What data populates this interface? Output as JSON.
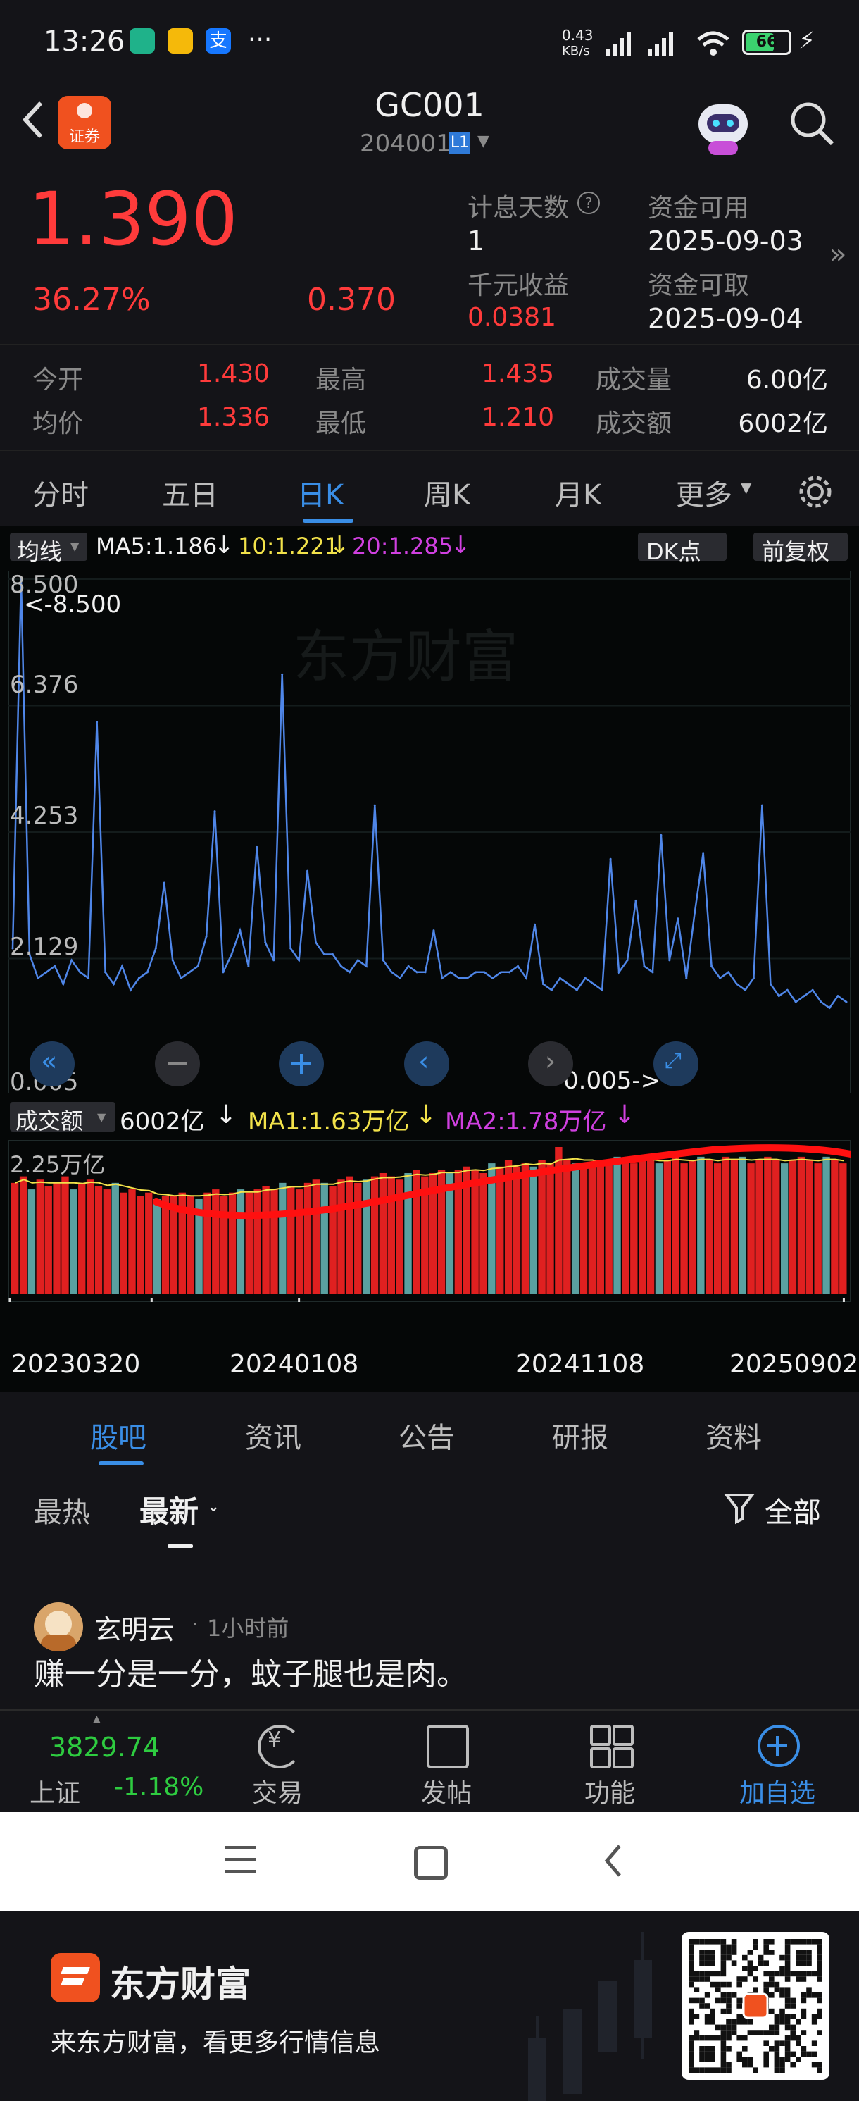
{
  "status_bar": {
    "time": "13:26",
    "net_speed_top": "0.43",
    "net_speed_unit": "KB/s",
    "battery": "66",
    "more": "···"
  },
  "header": {
    "title": "GC001",
    "code": "204001",
    "level": "L1",
    "badge_text": "证券"
  },
  "quote": {
    "price": "1.390",
    "change_pct": "36.27%",
    "change_abs": "0.370",
    "interest_days_label": "计息天数",
    "interest_days_value": "1",
    "per_thousand_label": "千元收益",
    "per_thousand_value": "0.0381",
    "funds_available_label": "资金可用",
    "funds_available_date": "2025-09-03",
    "funds_withdrawable_label": "资金可取",
    "funds_withdrawable_date": "2025-09-04"
  },
  "stats": [
    {
      "label": "今开",
      "value": "1.430"
    },
    {
      "label": "最高",
      "value": "1.435"
    },
    {
      "label": "成交量",
      "value": "6.00亿"
    },
    {
      "label": "均价",
      "value": "1.336"
    },
    {
      "label": "最低",
      "value": "1.210"
    },
    {
      "label": "成交额",
      "value": "6002亿"
    }
  ],
  "tabs": [
    "分时",
    "五日",
    "日K",
    "周K",
    "月K",
    "更多"
  ],
  "active_tab": "日K",
  "indicator_bar": {
    "selector": "均线",
    "ma5": "MA5:1.186",
    "ma10": "10:1.221",
    "ma20": "20:1.285",
    "dk": "DK点",
    "adjust": "前复权"
  },
  "price_chart_labels": {
    "y_top": "8.500",
    "y2": "6.376",
    "y3": "4.253",
    "y4": "2.129",
    "y_bottom": "0.005",
    "max_marker": "<-8.500",
    "min_marker": "0.005->",
    "watermark": "东方财富"
  },
  "volume_bar": {
    "selector": "成交额",
    "value": "6002亿",
    "ma1": "MA1:1.63万亿",
    "ma2": "MA2:1.78万亿",
    "y_top": "2.25万亿"
  },
  "x_dates": [
    "20230320",
    "20240108",
    "20241108",
    "20250902"
  ],
  "chart_data": {
    "type": "line",
    "title": "",
    "xlabel": "",
    "ylabel": "",
    "ylim": [
      0.005,
      8.5
    ],
    "x_range": [
      "20230320",
      "20250902"
    ],
    "series": [
      {
        "values": [
          2.3,
          8.5,
          2.2,
          1.8,
          1.9,
          2.0,
          1.7,
          2.1,
          1.9,
          1.8,
          6.1,
          1.9,
          1.7,
          2.0,
          1.6,
          1.8,
          1.9,
          2.3,
          3.4,
          2.1,
          1.8,
          1.9,
          2.0,
          2.5,
          4.6,
          1.9,
          2.2,
          2.6,
          2.0,
          4.0,
          2.4,
          2.1,
          6.9,
          2.3,
          2.1,
          3.6,
          2.4,
          2.2,
          2.2,
          2.0,
          1.9,
          2.1,
          2.0,
          4.7,
          2.1,
          1.9,
          1.8,
          2.0,
          1.9,
          1.9,
          2.6,
          1.8,
          1.9,
          1.8,
          1.8,
          1.9,
          1.9,
          1.8,
          1.9,
          1.9,
          2.0,
          1.8,
          2.7,
          1.7,
          1.6,
          1.8,
          1.7,
          1.6,
          1.8,
          1.7,
          1.6,
          3.8,
          1.9,
          2.1,
          3.1,
          2.0,
          1.9,
          4.2,
          2.1,
          2.8,
          1.8,
          2.9,
          3.9,
          2.0,
          1.8,
          1.9,
          1.7,
          1.6,
          1.8,
          4.7,
          1.7,
          1.5,
          1.6,
          1.4,
          1.5,
          1.6,
          1.4,
          1.3,
          1.5,
          1.4
        ]
      }
    ],
    "volume": {
      "ylim": [
        0,
        2.25
      ],
      "unit": "万亿",
      "values": [
        1.7,
        1.8,
        1.6,
        1.75,
        1.65,
        1.7,
        1.8,
        1.6,
        1.7,
        1.75,
        1.65,
        1.6,
        1.7,
        1.55,
        1.6,
        1.5,
        1.55,
        1.45,
        1.5,
        1.5,
        1.55,
        1.5,
        1.45,
        1.55,
        1.6,
        1.5,
        1.55,
        1.6,
        1.55,
        1.6,
        1.65,
        1.6,
        1.7,
        1.65,
        1.6,
        1.7,
        1.75,
        1.7,
        1.65,
        1.75,
        1.8,
        1.7,
        1.75,
        1.8,
        1.85,
        1.8,
        1.75,
        1.85,
        1.9,
        1.8,
        1.85,
        1.9,
        1.85,
        1.9,
        1.95,
        1.9,
        1.85,
        2.0,
        1.95,
        2.05,
        1.95,
        2.0,
        1.95,
        2.05,
        2.0,
        2.25,
        2.05,
        2.0,
        1.95,
        2.0,
        2.05,
        2.0,
        2.1,
        2.05,
        2.0,
        2.05,
        2.1,
        2.0,
        2.05,
        2.1,
        2.0,
        2.05,
        2.1,
        2.05,
        2.0,
        2.1,
        2.05,
        2.1,
        2.0,
        2.05,
        2.1,
        2.05,
        2.0,
        2.05,
        2.1,
        2.05,
        2.0,
        2.1,
        2.05,
        2.0
      ]
    }
  },
  "feed_tabs": [
    "股吧",
    "资讯",
    "公告",
    "研报",
    "资料"
  ],
  "active_feed_tab": "股吧",
  "sort": {
    "hot": "最热",
    "latest": "最新",
    "filter": "全部"
  },
  "post": {
    "author": "玄明云",
    "time": "1小时前",
    "content": "赚一分是一分，蚊子腿也是肉。"
  },
  "bottom_nav": {
    "index_value": "3829.74",
    "index_name": "上证",
    "index_change": "-1.18%",
    "items": [
      "交易",
      "发帖",
      "功能",
      "加自选"
    ]
  },
  "promo": {
    "brand": "东方财富",
    "slogan": "来东方财富，看更多行情信息"
  },
  "colors": {
    "up": "#ff3b3b",
    "down": "#2ecc40",
    "accent": "#3a8ee6",
    "ma10": "#f2e24a",
    "ma20": "#d040e0",
    "line": "#4f86e8"
  }
}
